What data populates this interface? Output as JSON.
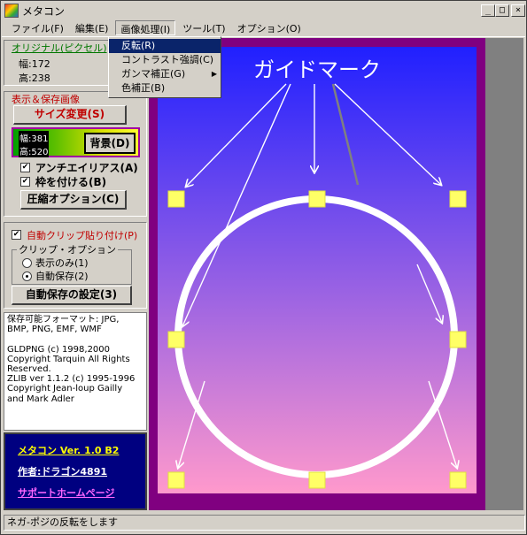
{
  "window": {
    "title": "メタコン"
  },
  "menubar": {
    "items": [
      "ファイル(F)",
      "編集(E)",
      "画像処理(I)",
      "ツール(T)",
      "オプション(O)"
    ]
  },
  "dropdown": {
    "items": [
      {
        "label": "反転(R)",
        "selected": true,
        "submenu": false
      },
      {
        "label": "コントラスト強調(C)",
        "selected": false,
        "submenu": false
      },
      {
        "label": "ガンマ補正(G)",
        "selected": false,
        "submenu": true
      },
      {
        "label": "色補正(B)",
        "selected": false,
        "submenu": false
      }
    ]
  },
  "original": {
    "header": "オリジナル(ピクセル)",
    "width_label": "幅:172",
    "height_label": "高:238"
  },
  "display": {
    "header": "表示＆保存画像",
    "resize_button": "サイズ変更(S)",
    "width_label": "幅:381",
    "height_label": "高:520",
    "background_button": "背景(D)",
    "antialias_label": "アンチエイリアス(A)",
    "antialias_checked": true,
    "frame_label": "枠を付ける(B)",
    "frame_checked": true,
    "compress_button": "圧縮オプション(C)"
  },
  "clip": {
    "auto_paste_label": "自動クリップ貼り付け(P)",
    "auto_paste_checked": true,
    "group_label": "クリップ・オプション",
    "option_display": "表示のみ(1)",
    "option_autosave": "自動保存(2)",
    "selected": "autosave",
    "autosave_settings_button": "自動保存の設定(3)"
  },
  "about": {
    "lines": [
      "保存可能フォーマット: JPG,",
      "BMP, PNG, EMF, WMF",
      "",
      "GLDPNG (c) 1998,2000",
      "Copyright Tarquin All Rights",
      "Reserved.",
      "ZLIB ver 1.1.2 (c) 1995-1996",
      "Copyright Jean-loup Gailly",
      "and Mark Adler"
    ]
  },
  "promo": {
    "version": "メタコン Ver. 1.0 B2",
    "author": "作者:ドラゴン4891",
    "support_link": "サポートホームページ"
  },
  "canvas": {
    "guide_label": "ガイドマーク",
    "frame_color": "#800080",
    "gradient_top": "#2020ff",
    "gradient_bottom": "#ff99cc",
    "marker_color": "#ffff66"
  },
  "statusbar": {
    "text": "ネガ-ポジの反転をします"
  },
  "icons": {
    "minimize": "minimize-icon",
    "maximize": "maximize-icon",
    "close": "close-icon"
  }
}
